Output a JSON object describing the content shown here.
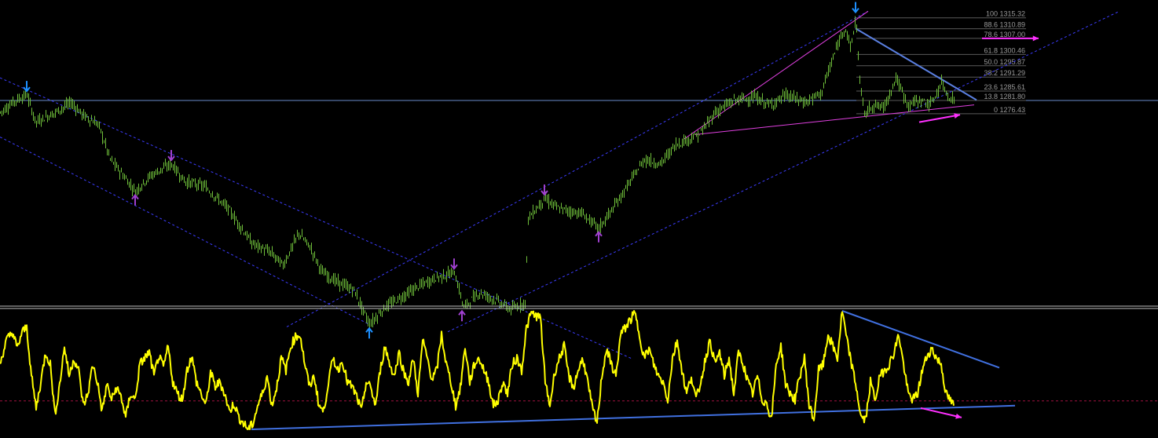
{
  "chart_data": [
    {
      "type": "candlestick",
      "panel": "price",
      "grid": false,
      "ylim": [
        1200,
        1320
      ],
      "horizontal_line": 1281.8,
      "fibonacci_levels": [
        {
          "level": "100",
          "price": "1315.32"
        },
        {
          "level": "88.6",
          "price": "1310.89"
        },
        {
          "level": "78.6",
          "price": "1307.00"
        },
        {
          "level": "61.8",
          "price": "1300.46"
        },
        {
          "level": "50.0",
          "price": "1295.87"
        },
        {
          "level": "38.2",
          "price": "1291.29"
        },
        {
          "level": "23.6",
          "price": "1285.61"
        },
        {
          "level": "13.8",
          "price": "1281.80"
        },
        {
          "level": "0",
          "price": "1276.43"
        }
      ],
      "price_path": [
        [
          0,
          1277
        ],
        [
          20,
          1282
        ],
        [
          34,
          1284
        ],
        [
          45,
          1273
        ],
        [
          70,
          1277
        ],
        [
          90,
          1281
        ],
        [
          105,
          1276
        ],
        [
          125,
          1272
        ],
        [
          140,
          1258
        ],
        [
          155,
          1252
        ],
        [
          172,
          1245
        ],
        [
          190,
          1251
        ],
        [
          205,
          1254
        ],
        [
          218,
          1256
        ],
        [
          235,
          1249
        ],
        [
          260,
          1247
        ],
        [
          290,
          1238
        ],
        [
          320,
          1224
        ],
        [
          345,
          1220
        ],
        [
          360,
          1215
        ],
        [
          380,
          1228
        ],
        [
          395,
          1222
        ],
        [
          410,
          1212
        ],
        [
          430,
          1208
        ],
        [
          450,
          1205
        ],
        [
          470,
          1191
        ],
        [
          490,
          1198
        ],
        [
          510,
          1202
        ],
        [
          530,
          1206
        ],
        [
          555,
          1210
        ],
        [
          578,
          1212
        ],
        [
          590,
          1198
        ],
        [
          610,
          1204
        ],
        [
          630,
          1201
        ],
        [
          650,
          1197
        ],
        [
          668,
          1200
        ],
        [
          672,
          1234
        ],
        [
          693,
          1242
        ],
        [
          710,
          1238
        ],
        [
          740,
          1236
        ],
        [
          762,
          1230
        ],
        [
          780,
          1238
        ],
        [
          800,
          1248
        ],
        [
          820,
          1258
        ],
        [
          840,
          1256
        ],
        [
          860,
          1264
        ],
        [
          890,
          1268
        ],
        [
          910,
          1277
        ],
        [
          935,
          1282
        ],
        [
          960,
          1283
        ],
        [
          980,
          1280
        ],
        [
          1000,
          1284
        ],
        [
          1025,
          1281
        ],
        [
          1045,
          1285
        ],
        [
          1060,
          1299
        ],
        [
          1075,
          1312
        ],
        [
          1083,
          1303
        ],
        [
          1089,
          1316
        ],
        [
          1094,
          1290
        ],
        [
          1100,
          1276
        ],
        [
          1110,
          1280
        ],
        [
          1125,
          1279
        ],
        [
          1140,
          1291
        ],
        [
          1155,
          1280
        ],
        [
          1170,
          1282
        ],
        [
          1185,
          1280
        ],
        [
          1198,
          1289
        ],
        [
          1208,
          1283
        ],
        [
          1215,
          1282
        ]
      ],
      "arrows": [
        {
          "x": 34,
          "price": 1284,
          "dir": "down",
          "color": "#1e90ff"
        },
        {
          "x": 218,
          "price": 1256,
          "dir": "down",
          "color": "#a040d0"
        },
        {
          "x": 172,
          "price": 1245,
          "dir": "up",
          "color": "#a040d0"
        },
        {
          "x": 470,
          "price": 1191,
          "dir": "up",
          "color": "#1e90ff"
        },
        {
          "x": 578,
          "price": 1212,
          "dir": "down",
          "color": "#a040d0"
        },
        {
          "x": 588,
          "price": 1198,
          "dir": "up",
          "color": "#a040d0"
        },
        {
          "x": 693,
          "price": 1242,
          "dir": "down",
          "color": "#a040d0"
        },
        {
          "x": 762,
          "price": 1230,
          "dir": "up",
          "color": "#a040d0"
        },
        {
          "x": 1089,
          "price": 1316,
          "dir": "down",
          "color": "#1e90ff"
        }
      ],
      "trendlines": [
        {
          "kind": "channel",
          "color": "#3c3cff",
          "style": "dashed",
          "from": [
            0,
            1291
          ],
          "to": [
            805,
            1177
          ]
        },
        {
          "kind": "channel",
          "color": "#3c3cff",
          "style": "dashed",
          "from": [
            0,
            1267
          ],
          "to": [
            470,
            1191
          ]
        },
        {
          "kind": "channel",
          "color": "#3c3cff",
          "style": "dashed",
          "from": [
            365,
            1190
          ],
          "to": [
            1105,
            1318
          ]
        },
        {
          "kind": "channel",
          "color": "#3c3cff",
          "style": "dashed",
          "from": [
            570,
            1188
          ],
          "to": [
            1425,
            1318
          ]
        },
        {
          "kind": "wedge",
          "color": "#e040e0",
          "style": "solid",
          "from": [
            870,
            1266
          ],
          "to": [
            1105,
            1318
          ]
        },
        {
          "kind": "wedge",
          "color": "#e040e0",
          "style": "solid",
          "from": [
            885,
            1268
          ],
          "to": [
            1240,
            1280
          ]
        },
        {
          "kind": "triangle",
          "color": "#5a7fe0",
          "style": "solid",
          "from": [
            1089,
            1311
          ],
          "to": [
            1243,
            1282
          ]
        }
      ],
      "signal_arrows": [
        {
          "color": "#ff30ff",
          "from": [
            1250,
            1307
          ],
          "to": [
            1322,
            1307
          ]
        },
        {
          "color": "#ff30ff",
          "from": [
            1170,
            1273
          ],
          "to": [
            1222,
            1276
          ]
        }
      ]
    },
    {
      "type": "line",
      "panel": "oscillator",
      "grid": false,
      "ylim": [
        0,
        100
      ],
      "color": "#ffff00",
      "reference_level": 24,
      "values": [
        [
          0,
          55
        ],
        [
          8,
          75
        ],
        [
          16,
          82
        ],
        [
          22,
          68
        ],
        [
          28,
          82
        ],
        [
          34,
          86
        ],
        [
          40,
          45
        ],
        [
          46,
          18
        ],
        [
          52,
          40
        ],
        [
          58,
          65
        ],
        [
          64,
          55
        ],
        [
          70,
          12
        ],
        [
          76,
          38
        ],
        [
          82,
          70
        ],
        [
          88,
          45
        ],
        [
          94,
          60
        ],
        [
          100,
          50
        ],
        [
          106,
          20
        ],
        [
          112,
          30
        ],
        [
          118,
          55
        ],
        [
          124,
          40
        ],
        [
          130,
          15
        ],
        [
          136,
          38
        ],
        [
          142,
          25
        ],
        [
          148,
          35
        ],
        [
          154,
          28
        ],
        [
          160,
          10
        ],
        [
          166,
          30
        ],
        [
          172,
          25
        ],
        [
          178,
          55
        ],
        [
          184,
          60
        ],
        [
          190,
          65
        ],
        [
          196,
          45
        ],
        [
          202,
          62
        ],
        [
          208,
          52
        ],
        [
          214,
          70
        ],
        [
          220,
          40
        ],
        [
          226,
          30
        ],
        [
          232,
          25
        ],
        [
          238,
          50
        ],
        [
          244,
          62
        ],
        [
          250,
          40
        ],
        [
          256,
          30
        ],
        [
          262,
          20
        ],
        [
          268,
          48
        ],
        [
          274,
          36
        ],
        [
          280,
          40
        ],
        [
          286,
          30
        ],
        [
          292,
          15
        ],
        [
          298,
          22
        ],
        [
          304,
          10
        ],
        [
          310,
          5
        ],
        [
          316,
          0
        ],
        [
          322,
          5
        ],
        [
          328,
          20
        ],
        [
          334,
          30
        ],
        [
          340,
          45
        ],
        [
          346,
          20
        ],
        [
          352,
          35
        ],
        [
          358,
          60
        ],
        [
          364,
          50
        ],
        [
          370,
          70
        ],
        [
          376,
          78
        ],
        [
          382,
          80
        ],
        [
          388,
          55
        ],
        [
          394,
          36
        ],
        [
          400,
          45
        ],
        [
          406,
          20
        ],
        [
          412,
          15
        ],
        [
          418,
          40
        ],
        [
          424,
          60
        ],
        [
          430,
          50
        ],
        [
          436,
          58
        ],
        [
          442,
          40
        ],
        [
          448,
          36
        ],
        [
          454,
          28
        ],
        [
          460,
          15
        ],
        [
          466,
          40
        ],
        [
          472,
          35
        ],
        [
          478,
          20
        ],
        [
          484,
          50
        ],
        [
          490,
          70
        ],
        [
          496,
          55
        ],
        [
          502,
          45
        ],
        [
          508,
          65
        ],
        [
          514,
          48
        ],
        [
          520,
          40
        ],
        [
          526,
          60
        ],
        [
          532,
          30
        ],
        [
          538,
          75
        ],
        [
          544,
          60
        ],
        [
          550,
          42
        ],
        [
          556,
          50
        ],
        [
          562,
          80
        ],
        [
          568,
          55
        ],
        [
          574,
          40
        ],
        [
          580,
          20
        ],
        [
          586,
          35
        ],
        [
          592,
          70
        ],
        [
          598,
          40
        ],
        [
          604,
          55
        ],
        [
          610,
          60
        ],
        [
          616,
          50
        ],
        [
          622,
          40
        ],
        [
          628,
          20
        ],
        [
          634,
          24
        ],
        [
          640,
          40
        ],
        [
          646,
          30
        ],
        [
          652,
          55
        ],
        [
          658,
          60
        ],
        [
          664,
          50
        ],
        [
          670,
          85
        ],
        [
          676,
          98
        ],
        [
          682,
          96
        ],
        [
          688,
          94
        ],
        [
          694,
          40
        ],
        [
          700,
          20
        ],
        [
          706,
          48
        ],
        [
          712,
          60
        ],
        [
          718,
          70
        ],
        [
          724,
          45
        ],
        [
          730,
          35
        ],
        [
          736,
          50
        ],
        [
          742,
          60
        ],
        [
          748,
          40
        ],
        [
          754,
          18
        ],
        [
          760,
          5
        ],
        [
          766,
          45
        ],
        [
          772,
          68
        ],
        [
          778,
          55
        ],
        [
          784,
          45
        ],
        [
          790,
          80
        ],
        [
          796,
          86
        ],
        [
          802,
          92
        ],
        [
          808,
          98
        ],
        [
          814,
          80
        ],
        [
          820,
          60
        ],
        [
          826,
          68
        ],
        [
          832,
          55
        ],
        [
          838,
          45
        ],
        [
          844,
          40
        ],
        [
          850,
          25
        ],
        [
          856,
          60
        ],
        [
          862,
          75
        ],
        [
          868,
          50
        ],
        [
          874,
          30
        ],
        [
          880,
          45
        ],
        [
          886,
          25
        ],
        [
          892,
          40
        ],
        [
          898,
          60
        ],
        [
          904,
          75
        ],
        [
          910,
          55
        ],
        [
          916,
          65
        ],
        [
          922,
          45
        ],
        [
          928,
          60
        ],
        [
          934,
          30
        ],
        [
          940,
          65
        ],
        [
          946,
          55
        ],
        [
          952,
          40
        ],
        [
          958,
          30
        ],
        [
          964,
          45
        ],
        [
          970,
          25
        ],
        [
          976,
          22
        ],
        [
          982,
          8
        ],
        [
          988,
          55
        ],
        [
          994,
          70
        ],
        [
          1000,
          38
        ],
        [
          1006,
          30
        ],
        [
          1012,
          25
        ],
        [
          1018,
          45
        ],
        [
          1024,
          60
        ],
        [
          1030,
          20
        ],
        [
          1036,
          8
        ],
        [
          1042,
          50
        ],
        [
          1048,
          55
        ],
        [
          1054,
          80
        ],
        [
          1060,
          70
        ],
        [
          1066,
          60
        ],
        [
          1072,
          100
        ],
        [
          1078,
          75
        ],
        [
          1084,
          55
        ],
        [
          1090,
          35
        ],
        [
          1096,
          10
        ],
        [
          1102,
          8
        ],
        [
          1108,
          40
        ],
        [
          1114,
          25
        ],
        [
          1120,
          45
        ],
        [
          1126,
          50
        ],
        [
          1132,
          55
        ],
        [
          1138,
          65
        ],
        [
          1144,
          80
        ],
        [
          1150,
          55
        ],
        [
          1156,
          30
        ],
        [
          1162,
          25
        ],
        [
          1168,
          30
        ],
        [
          1174,
          50
        ],
        [
          1180,
          62
        ],
        [
          1186,
          68
        ],
        [
          1192,
          60
        ],
        [
          1198,
          55
        ],
        [
          1204,
          30
        ],
        [
          1210,
          24
        ],
        [
          1214,
          20
        ]
      ],
      "trendlines": [
        {
          "color": "#4070e0",
          "from": [
            1072,
            100
          ],
          "to": [
            1272,
            52
          ]
        },
        {
          "color": "#4070e0",
          "from": [
            320,
            0
          ],
          "to": [
            1292,
            20
          ]
        }
      ],
      "signal_arrows": [
        {
          "color": "#ff30ff",
          "from": [
            1172,
            18
          ],
          "to": [
            1224,
            10
          ]
        }
      ]
    }
  ]
}
